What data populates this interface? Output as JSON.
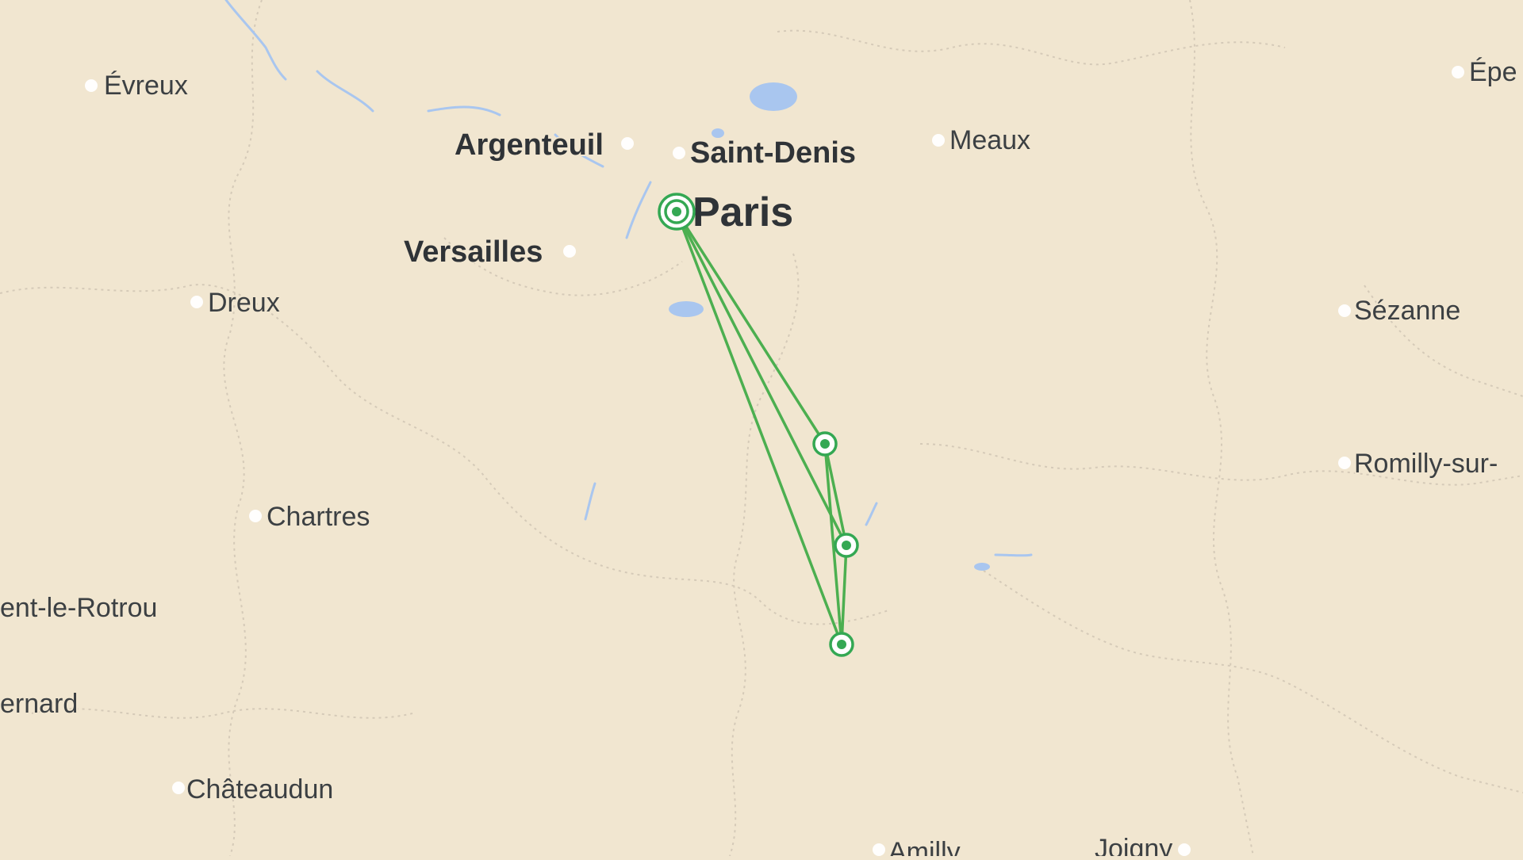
{
  "map": {
    "colors": {
      "land": "#f1e6d0",
      "water": "#a9c6ef",
      "boundary": "#d5cab8",
      "route": "#4caf50",
      "marker": "#34a853",
      "label": "#3c4043"
    },
    "cities": [
      {
        "key": "evreux",
        "label": "Évreux"
      },
      {
        "key": "argenteuil",
        "label": "Argenteuil"
      },
      {
        "key": "saint-denis",
        "label": "Saint-Denis"
      },
      {
        "key": "meaux",
        "label": "Meaux"
      },
      {
        "key": "epernay",
        "label": "Épe"
      },
      {
        "key": "paris",
        "label": "Paris"
      },
      {
        "key": "versailles",
        "label": "Versailles"
      },
      {
        "key": "dreux",
        "label": "Dreux"
      },
      {
        "key": "sezanne",
        "label": "Sézanne"
      },
      {
        "key": "romilly",
        "label": "Romilly-sur-"
      },
      {
        "key": "chartres",
        "label": "Chartres"
      },
      {
        "key": "nogent",
        "label": "ent-le-Rotrou"
      },
      {
        "key": "bernard",
        "label": "ernard"
      },
      {
        "key": "chateaudun",
        "label": "Châteaudun"
      },
      {
        "key": "amilly",
        "label": "Amilly"
      },
      {
        "key": "joigny",
        "label": "Joigny"
      }
    ],
    "route": {
      "stops": [
        "origin-paris",
        "stop-1",
        "stop-2",
        "stop-3"
      ],
      "legs": [
        [
          "origin-paris",
          "stop-1"
        ],
        [
          "origin-paris",
          "stop-2"
        ],
        [
          "origin-paris",
          "stop-3"
        ],
        [
          "stop-1",
          "stop-2"
        ],
        [
          "stop-1",
          "stop-3"
        ],
        [
          "stop-2",
          "stop-3"
        ]
      ]
    }
  }
}
